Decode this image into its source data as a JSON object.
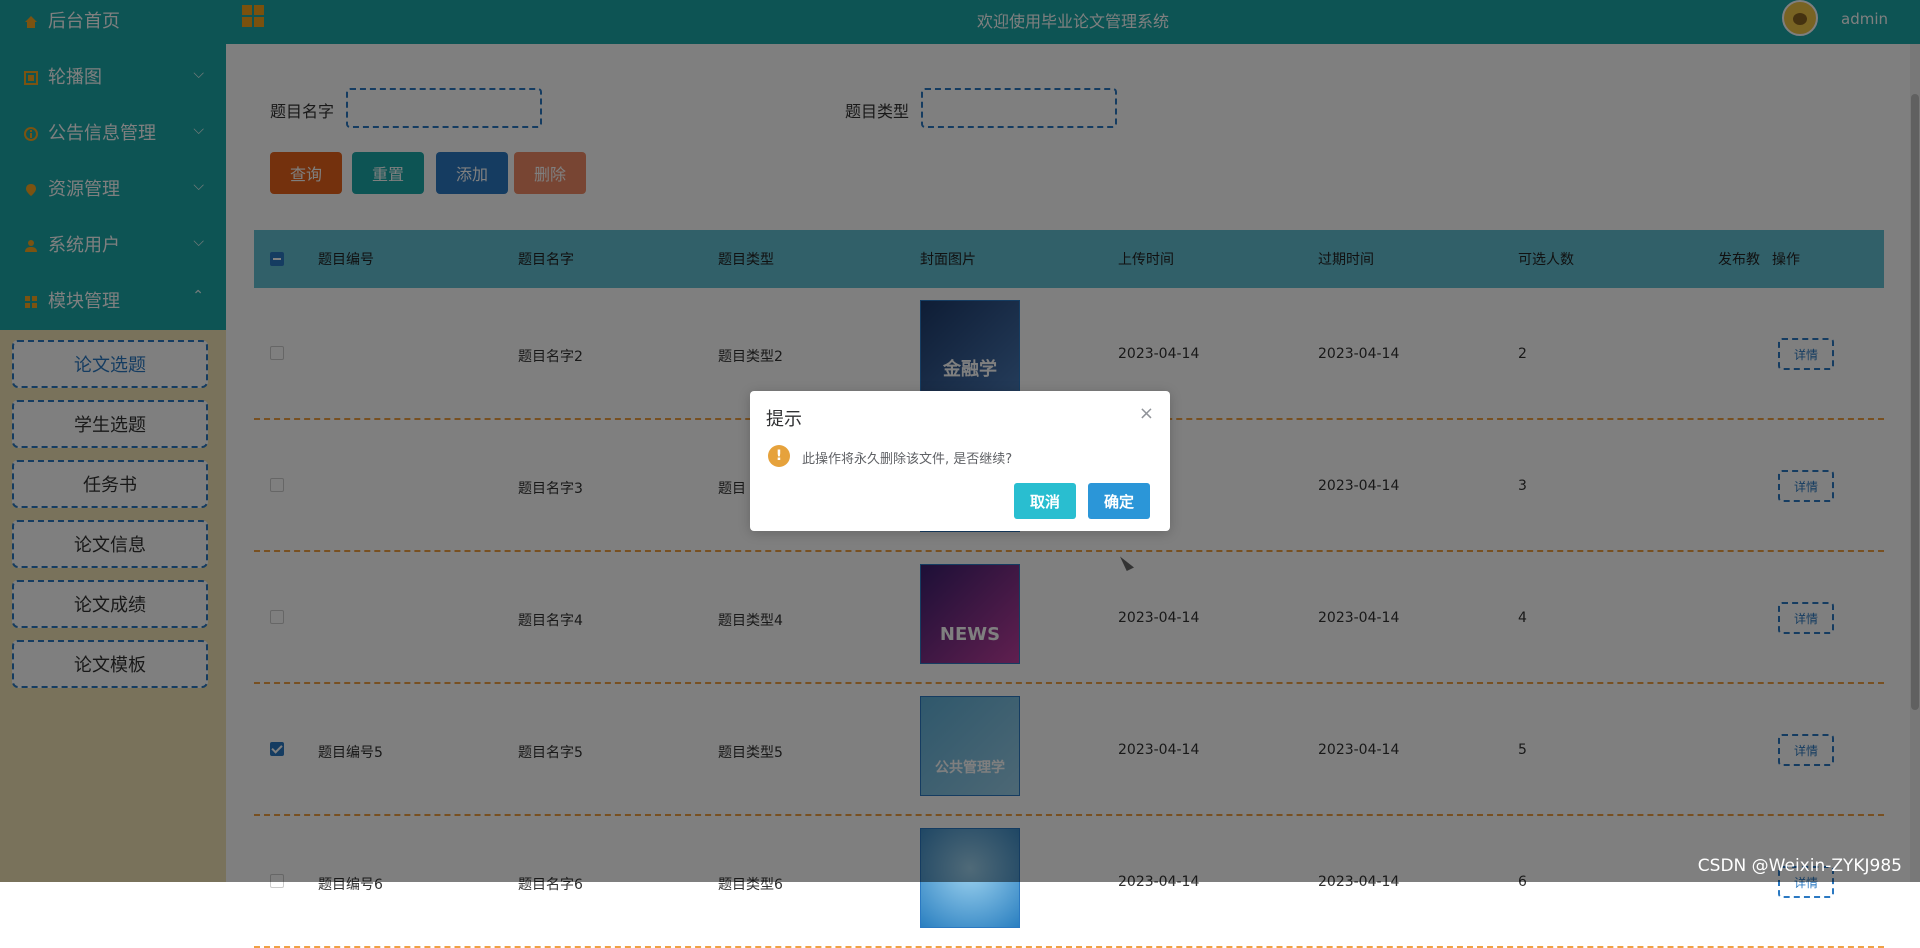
{
  "header": {
    "system_title": "欢迎使用毕业论文管理系统",
    "username": "admin"
  },
  "sidebar": {
    "items": [
      {
        "label": "后台首页",
        "icon": "home-icon",
        "expanded": false
      },
      {
        "label": "轮播图",
        "icon": "image-icon",
        "expanded": false
      },
      {
        "label": "公告信息管理",
        "icon": "info-icon",
        "expanded": false
      },
      {
        "label": "资源管理",
        "icon": "location-icon",
        "expanded": false
      },
      {
        "label": "系统用户",
        "icon": "user-icon",
        "expanded": false
      },
      {
        "label": "模块管理",
        "icon": "grid-icon",
        "expanded": true
      }
    ],
    "submenu": [
      {
        "label": "论文选题",
        "active": true
      },
      {
        "label": "学生选题",
        "active": false
      },
      {
        "label": "任务书",
        "active": false
      },
      {
        "label": "论文信息",
        "active": false
      },
      {
        "label": "论文成绩",
        "active": false
      },
      {
        "label": "论文模板",
        "active": false
      }
    ]
  },
  "search": {
    "name_label": "题目名字",
    "type_label": "题目类型",
    "name_value": "",
    "type_value": ""
  },
  "buttons": {
    "query": "查询",
    "reset": "重置",
    "add": "添加",
    "delete": "删除"
  },
  "table": {
    "columns": [
      "题目编号",
      "题目名字",
      "题目类型",
      "封面图片",
      "上传时间",
      "过期时间",
      "可选人数",
      "发布教师",
      "操作"
    ],
    "column_visible_text": [
      "题目编号",
      "题目名字",
      "题目类型",
      "封面图片",
      "上传时间",
      "过期时间",
      "可选人数",
      "发布教",
      "操作"
    ],
    "rows": [
      {
        "checked": false,
        "number": "",
        "name": "题目名字2",
        "type": "题目类型2",
        "cover": "金融学",
        "upload": "2023-04-14",
        "expire": "2023-04-14",
        "count": "2",
        "action": "详情"
      },
      {
        "checked": false,
        "number": "",
        "name": "题目名字3",
        "type": "题目",
        "cover": "",
        "upload": "4",
        "expire": "2023-04-14",
        "count": "3",
        "action": "详情"
      },
      {
        "checked": false,
        "number": "",
        "name": "题目名字4",
        "type": "题目类型4",
        "cover": "NEWS",
        "upload": "2023-04-14",
        "expire": "2023-04-14",
        "count": "4",
        "action": "详情"
      },
      {
        "checked": true,
        "number": "题目编号5",
        "name": "题目名字5",
        "type": "题目类型5",
        "cover": "公共管理学",
        "upload": "2023-04-14",
        "expire": "2023-04-14",
        "count": "5",
        "action": "详情"
      },
      {
        "checked": false,
        "number": "题目编号6",
        "name": "题目名字6",
        "type": "题目类型6",
        "cover": "",
        "upload": "2023-04-14",
        "expire": "2023-04-14",
        "count": "6",
        "action": "详情"
      }
    ]
  },
  "dialog": {
    "title": "提示",
    "message": "此操作将永久删除该文件, 是否继续?",
    "cancel": "取消",
    "confirm": "确定",
    "close_symbol": "×",
    "warn_symbol": "!"
  },
  "watermark": "CSDN @Weixin-ZYKJ985",
  "colors": {
    "accent": "#1aa9a8",
    "primary": "#2b79c2",
    "query_btn": "#e8631a",
    "reset_btn": "#1aa9a8",
    "add_btn": "#2b79c2",
    "delete_btn": "#f08a66",
    "warning": "#e6a23c"
  }
}
